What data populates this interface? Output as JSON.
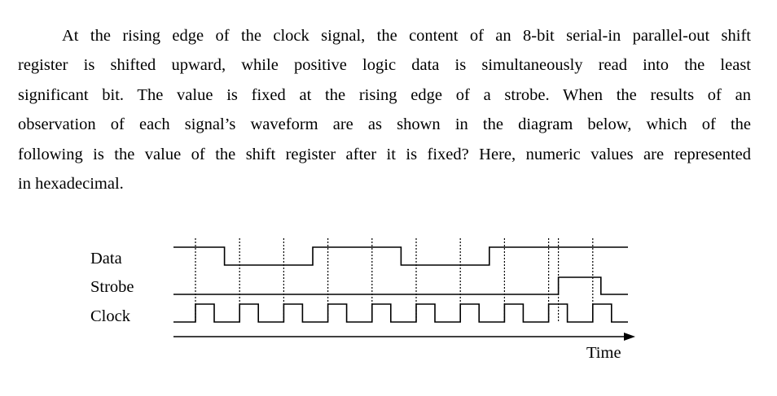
{
  "question": {
    "lines": [
      "At the rising edge of the clock signal, the content of an 8-bit serial-in parallel-out shift",
      "register is shifted upward, while positive logic data is simultaneously read into the least",
      "significant bit. The value is fixed at the rising edge of a strobe. When the results of an",
      "observation of each signal’s waveform are as shown in the diagram below, which of the",
      "following is the value of the shift register after it is fixed? Here, numeric values are represented",
      "in hexadecimal."
    ]
  },
  "diagram": {
    "signal_labels": {
      "data": "Data",
      "strobe": "Strobe",
      "clock": "Clock"
    },
    "time_label": "Time",
    "clock_pulses": 10,
    "data_levels_per_period": [
      1,
      0,
      0,
      1,
      1,
      0,
      0,
      1,
      1,
      1
    ],
    "strobe_high_after_rising_edge": 9
  }
}
